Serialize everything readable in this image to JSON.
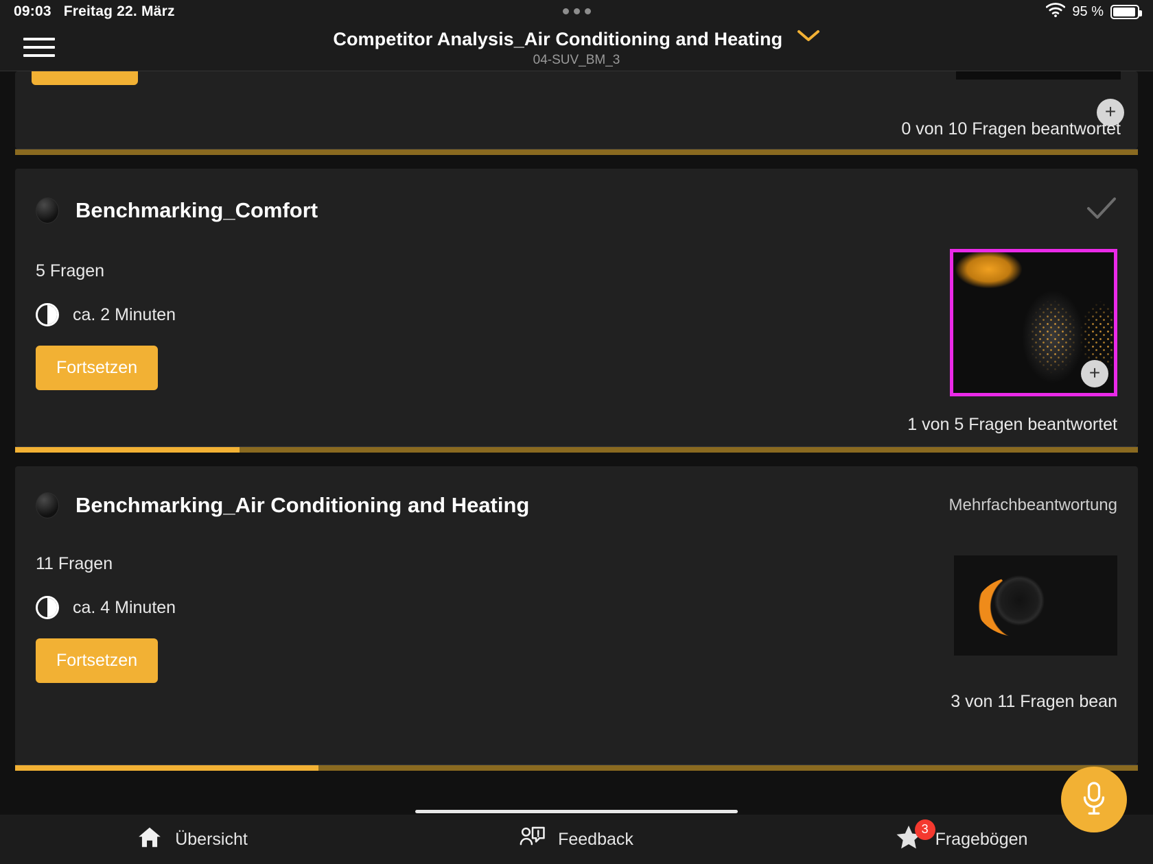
{
  "status_bar": {
    "time": "09:03",
    "date": "Freitag 22. März",
    "battery_percent": "95 %",
    "wifi_icon": "wifi-icon",
    "battery_icon": "battery-icon",
    "dots_icon": "three-dots-icon"
  },
  "header": {
    "menu_icon": "hamburger-menu-icon",
    "title": "Competitor Analysis_Air Conditioning and Heating",
    "subtitle": "04-SUV_BM_3",
    "chevron_icon": "chevron-down-icon",
    "chevron_color": "#f2b134"
  },
  "theme": {
    "accent": "#f2b134",
    "progress_track": "#8a6a20",
    "highlight_border": "#ea2ae8",
    "badge_red": "#f4392f",
    "card_bg": "#212121",
    "page_bg": "#111111"
  },
  "cards": [
    {
      "id": "partial-top-card",
      "button_label": "",
      "status_text": "0 von 10 Fragen beantwortet",
      "plus_icon": "plus-icon",
      "progress_percent": 0,
      "answered": 0,
      "total": 10
    },
    {
      "id": "benchmarking-comfort",
      "title": "Benchmarking_Comfort",
      "bullet_icon": "status-dot-icon",
      "check_icon": "checkmark-icon",
      "question_count": "5 Fragen",
      "duration": "ca. 2 Minuten",
      "clock_icon": "clock-icon",
      "button_label": "Fortsetzen",
      "status_text": "1 von 5 Fragen beantwortet",
      "plus_icon": "plus-icon",
      "thumbnail_alt": "car-interior-seats-photo",
      "highlighted": true,
      "progress_percent": 20,
      "answered": 1,
      "total": 5
    },
    {
      "id": "benchmarking-air-conditioning-and-heating",
      "title": "Benchmarking_Air Conditioning and Heating",
      "bullet_icon": "status-dot-icon",
      "tag": "Mehrfachbeantwortung",
      "question_count": "11 Fragen",
      "duration": "ca. 4 Minuten",
      "clock_icon": "clock-icon",
      "button_label": "Fortsetzen",
      "status_text": "3 von 11 Fragen bean",
      "thumbnail_alt": "climate-control-dial-photo",
      "highlighted": false,
      "progress_percent": 27,
      "answered": 3,
      "total": 11
    }
  ],
  "fab": {
    "icon": "microphone-icon",
    "color": "#f2b134"
  },
  "bottom_nav": [
    {
      "label": "Übersicht",
      "icon": "home-icon",
      "badge": ""
    },
    {
      "label": "Feedback",
      "icon": "feedback-icon",
      "badge": ""
    },
    {
      "label": "Fragebögen",
      "icon": "star-icon",
      "badge": "3"
    }
  ]
}
